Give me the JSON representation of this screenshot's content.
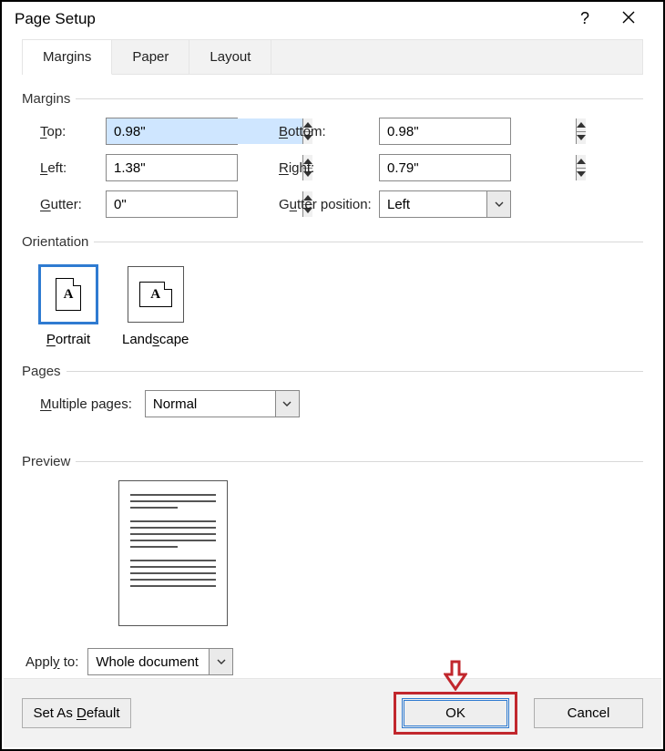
{
  "title": "Page Setup",
  "tabs": {
    "margins": "Margins",
    "paper": "Paper",
    "layout": "Layout",
    "active": "margins"
  },
  "sections": {
    "margins": "Margins",
    "orientation": "Orientation",
    "pages": "Pages",
    "preview": "Preview"
  },
  "margins": {
    "top_label": "Top:",
    "top_value": "0.98\"",
    "bottom_label": "Bottom:",
    "bottom_value": "0.98\"",
    "left_label": "Left:",
    "left_value": "1.38\"",
    "right_label": "Right:",
    "right_value": "0.79\"",
    "gutter_label": "Gutter:",
    "gutter_value": "0\"",
    "gutterpos_label": "Gutter position:",
    "gutterpos_value": "Left"
  },
  "orientation": {
    "portrait": "Portrait",
    "landscape": "Landscape",
    "selected": "portrait"
  },
  "pages": {
    "label": "Multiple pages:",
    "value": "Normal"
  },
  "apply": {
    "label": "Apply to:",
    "value": "Whole document"
  },
  "buttons": {
    "default": "Set As Default",
    "ok": "OK",
    "cancel": "Cancel"
  }
}
